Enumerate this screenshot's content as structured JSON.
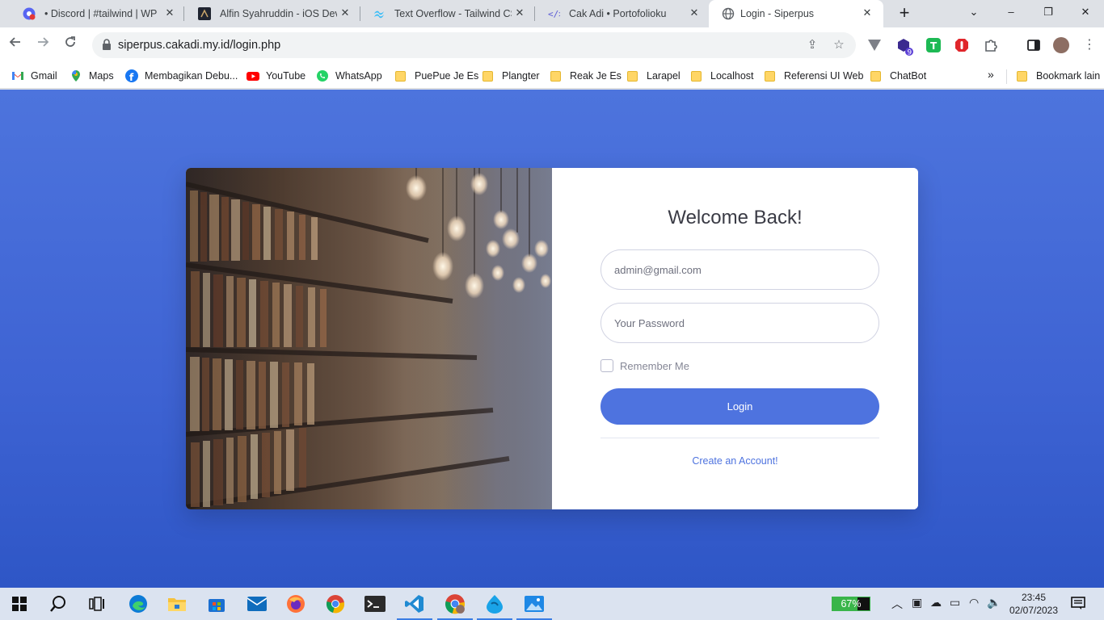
{
  "browser": {
    "tabs": [
      {
        "title": "• Discord | #tailwind | WPU",
        "icon": "discord-icon",
        "active": false
      },
      {
        "title": "Alfin Syahruddin - iOS Deve",
        "icon": "alfin-site-icon",
        "active": false
      },
      {
        "title": "Text Overflow - Tailwind CSS",
        "icon": "tailwind-icon",
        "active": false
      },
      {
        "title": "Cak Adi • Portofolioku",
        "icon": "portfolio-icon",
        "active": false
      },
      {
        "title": "Login - Siperpus",
        "icon": "globe-icon",
        "active": true
      }
    ],
    "url": "siperpus.cakadi.my.id/login.php",
    "bookmarks": [
      {
        "label": "Gmail",
        "icon": "gmail-icon"
      },
      {
        "label": "Maps",
        "icon": "maps-icon"
      },
      {
        "label": "Membagikan Debu...",
        "icon": "facebook-icon"
      },
      {
        "label": "YouTube",
        "icon": "youtube-icon"
      },
      {
        "label": "WhatsApp",
        "icon": "whatsapp-icon"
      },
      {
        "label": "PuePue Je Es",
        "icon": "folder-icon"
      },
      {
        "label": "Plangter",
        "icon": "folder-icon"
      },
      {
        "label": "Reak Je Es",
        "icon": "folder-icon"
      },
      {
        "label": "Larapel",
        "icon": "folder-icon"
      },
      {
        "label": "Localhost",
        "icon": "folder-icon"
      },
      {
        "label": "Referensi UI Web",
        "icon": "folder-icon"
      },
      {
        "label": "ChatBot",
        "icon": "folder-icon"
      }
    ],
    "bookmarks_more": "»",
    "other_bookmarks": "Bookmark lain",
    "extension_badge": "9"
  },
  "login": {
    "heading": "Welcome Back!",
    "email_placeholder": "admin@gmail.com",
    "password_placeholder": "Your Password",
    "remember_label": "Remember Me",
    "login_button": "Login",
    "create_account_link": "Create an Account!"
  },
  "taskbar": {
    "battery_percent": "67%",
    "battery_level": 0.67,
    "time": "23:45",
    "date": "02/07/2023"
  },
  "colors": {
    "page_bg": "#4e73df",
    "button": "#4e73df",
    "link": "#4e73df"
  }
}
